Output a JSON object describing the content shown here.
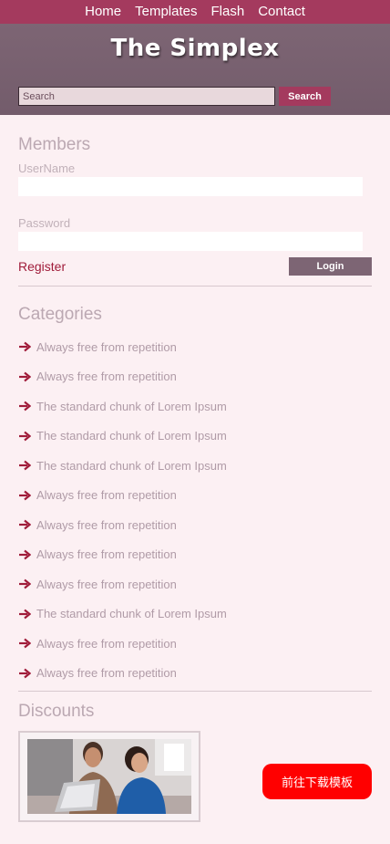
{
  "nav": {
    "items": [
      "Home",
      "Templates",
      "Flash",
      "Contact"
    ]
  },
  "header": {
    "title": "The Simplex"
  },
  "search": {
    "placeholder": "Search",
    "button_label": "Search"
  },
  "members": {
    "title": "Members",
    "username_label": "UserName",
    "password_label": "Password",
    "register_label": "Register",
    "login_label": "Login"
  },
  "categories": {
    "title": "Categories",
    "items": [
      "Always free from repetition",
      "Always free from repetition",
      "The standard chunk of Lorem Ipsum",
      "The standard chunk of Lorem Ipsum",
      "The standard chunk of Lorem Ipsum",
      "Always free from repetition",
      "Always free from repetition",
      "Always free from repetition",
      "Always free from repetition",
      "The standard chunk of Lorem Ipsum",
      "Always free from repetition",
      "Always free from repetition"
    ]
  },
  "discounts": {
    "title": "Discounts"
  },
  "floating": {
    "download_label": "前往下载模板"
  },
  "colors": {
    "nav_bg": "#a43a5e",
    "header_bg": "#7d6574",
    "page_bg": "#fcf0f3",
    "accent": "#a01c3a",
    "download_bg": "#ff0000"
  }
}
